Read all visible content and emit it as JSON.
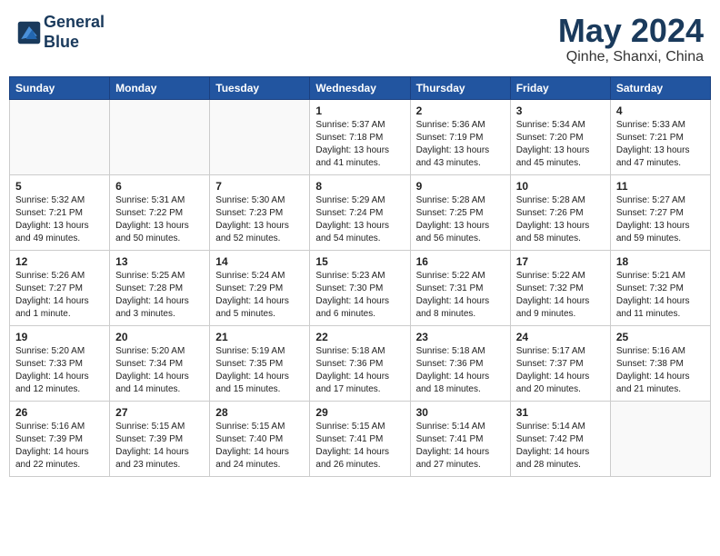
{
  "header": {
    "logo_line1": "General",
    "logo_line2": "Blue",
    "month_title": "May 2024",
    "location": "Qinhe, Shanxi, China"
  },
  "weekdays": [
    "Sunday",
    "Monday",
    "Tuesday",
    "Wednesday",
    "Thursday",
    "Friday",
    "Saturday"
  ],
  "weeks": [
    [
      {
        "day": "",
        "text": ""
      },
      {
        "day": "",
        "text": ""
      },
      {
        "day": "",
        "text": ""
      },
      {
        "day": "1",
        "text": "Sunrise: 5:37 AM\nSunset: 7:18 PM\nDaylight: 13 hours\nand 41 minutes."
      },
      {
        "day": "2",
        "text": "Sunrise: 5:36 AM\nSunset: 7:19 PM\nDaylight: 13 hours\nand 43 minutes."
      },
      {
        "day": "3",
        "text": "Sunrise: 5:34 AM\nSunset: 7:20 PM\nDaylight: 13 hours\nand 45 minutes."
      },
      {
        "day": "4",
        "text": "Sunrise: 5:33 AM\nSunset: 7:21 PM\nDaylight: 13 hours\nand 47 minutes."
      }
    ],
    [
      {
        "day": "5",
        "text": "Sunrise: 5:32 AM\nSunset: 7:21 PM\nDaylight: 13 hours\nand 49 minutes."
      },
      {
        "day": "6",
        "text": "Sunrise: 5:31 AM\nSunset: 7:22 PM\nDaylight: 13 hours\nand 50 minutes."
      },
      {
        "day": "7",
        "text": "Sunrise: 5:30 AM\nSunset: 7:23 PM\nDaylight: 13 hours\nand 52 minutes."
      },
      {
        "day": "8",
        "text": "Sunrise: 5:29 AM\nSunset: 7:24 PM\nDaylight: 13 hours\nand 54 minutes."
      },
      {
        "day": "9",
        "text": "Sunrise: 5:28 AM\nSunset: 7:25 PM\nDaylight: 13 hours\nand 56 minutes."
      },
      {
        "day": "10",
        "text": "Sunrise: 5:28 AM\nSunset: 7:26 PM\nDaylight: 13 hours\nand 58 minutes."
      },
      {
        "day": "11",
        "text": "Sunrise: 5:27 AM\nSunset: 7:27 PM\nDaylight: 13 hours\nand 59 minutes."
      }
    ],
    [
      {
        "day": "12",
        "text": "Sunrise: 5:26 AM\nSunset: 7:27 PM\nDaylight: 14 hours\nand 1 minute."
      },
      {
        "day": "13",
        "text": "Sunrise: 5:25 AM\nSunset: 7:28 PM\nDaylight: 14 hours\nand 3 minutes."
      },
      {
        "day": "14",
        "text": "Sunrise: 5:24 AM\nSunset: 7:29 PM\nDaylight: 14 hours\nand 5 minutes."
      },
      {
        "day": "15",
        "text": "Sunrise: 5:23 AM\nSunset: 7:30 PM\nDaylight: 14 hours\nand 6 minutes."
      },
      {
        "day": "16",
        "text": "Sunrise: 5:22 AM\nSunset: 7:31 PM\nDaylight: 14 hours\nand 8 minutes."
      },
      {
        "day": "17",
        "text": "Sunrise: 5:22 AM\nSunset: 7:32 PM\nDaylight: 14 hours\nand 9 minutes."
      },
      {
        "day": "18",
        "text": "Sunrise: 5:21 AM\nSunset: 7:32 PM\nDaylight: 14 hours\nand 11 minutes."
      }
    ],
    [
      {
        "day": "19",
        "text": "Sunrise: 5:20 AM\nSunset: 7:33 PM\nDaylight: 14 hours\nand 12 minutes."
      },
      {
        "day": "20",
        "text": "Sunrise: 5:20 AM\nSunset: 7:34 PM\nDaylight: 14 hours\nand 14 minutes."
      },
      {
        "day": "21",
        "text": "Sunrise: 5:19 AM\nSunset: 7:35 PM\nDaylight: 14 hours\nand 15 minutes."
      },
      {
        "day": "22",
        "text": "Sunrise: 5:18 AM\nSunset: 7:36 PM\nDaylight: 14 hours\nand 17 minutes."
      },
      {
        "day": "23",
        "text": "Sunrise: 5:18 AM\nSunset: 7:36 PM\nDaylight: 14 hours\nand 18 minutes."
      },
      {
        "day": "24",
        "text": "Sunrise: 5:17 AM\nSunset: 7:37 PM\nDaylight: 14 hours\nand 20 minutes."
      },
      {
        "day": "25",
        "text": "Sunrise: 5:16 AM\nSunset: 7:38 PM\nDaylight: 14 hours\nand 21 minutes."
      }
    ],
    [
      {
        "day": "26",
        "text": "Sunrise: 5:16 AM\nSunset: 7:39 PM\nDaylight: 14 hours\nand 22 minutes."
      },
      {
        "day": "27",
        "text": "Sunrise: 5:15 AM\nSunset: 7:39 PM\nDaylight: 14 hours\nand 23 minutes."
      },
      {
        "day": "28",
        "text": "Sunrise: 5:15 AM\nSunset: 7:40 PM\nDaylight: 14 hours\nand 24 minutes."
      },
      {
        "day": "29",
        "text": "Sunrise: 5:15 AM\nSunset: 7:41 PM\nDaylight: 14 hours\nand 26 minutes."
      },
      {
        "day": "30",
        "text": "Sunrise: 5:14 AM\nSunset: 7:41 PM\nDaylight: 14 hours\nand 27 minutes."
      },
      {
        "day": "31",
        "text": "Sunrise: 5:14 AM\nSunset: 7:42 PM\nDaylight: 14 hours\nand 28 minutes."
      },
      {
        "day": "",
        "text": ""
      }
    ]
  ]
}
